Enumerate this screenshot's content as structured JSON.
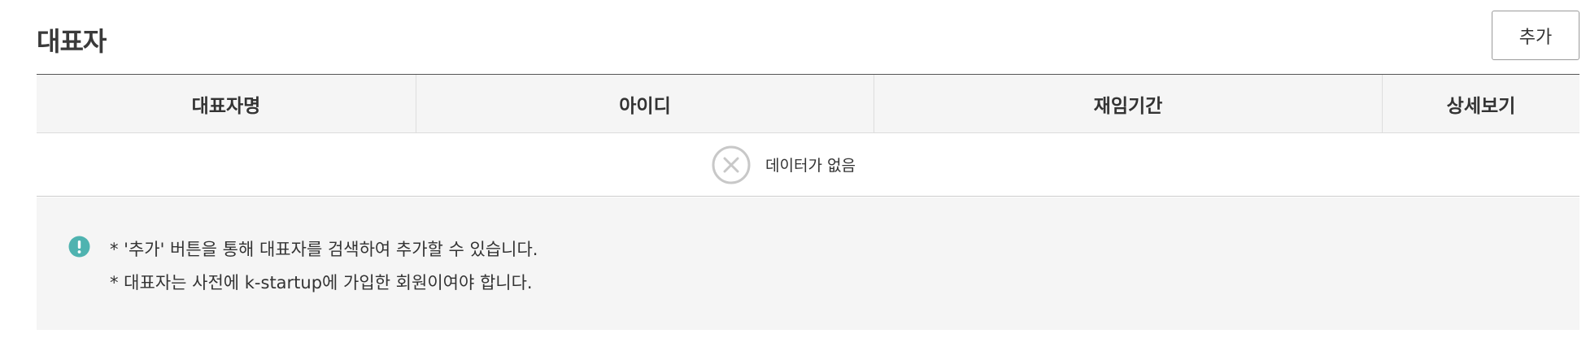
{
  "section": {
    "title": "대표자",
    "add_label": "추가"
  },
  "table": {
    "columns": [
      "대표자명",
      "아이디",
      "재임기간",
      "상세보기"
    ],
    "empty_text": "데이터가 없음"
  },
  "notice": {
    "icon": "exclamation-circle-icon",
    "lines": [
      "* '추가' 버튼을 통해 대표자를 검색하여 추가할 수 있습니다.",
      "* 대표자는 사전에 k-startup에 가입한 회원이여야 합니다."
    ]
  },
  "colors": {
    "notice_icon": "#4fb3b0",
    "header_bg": "#f5f5f5",
    "empty_icon": "#c8c8c8"
  }
}
